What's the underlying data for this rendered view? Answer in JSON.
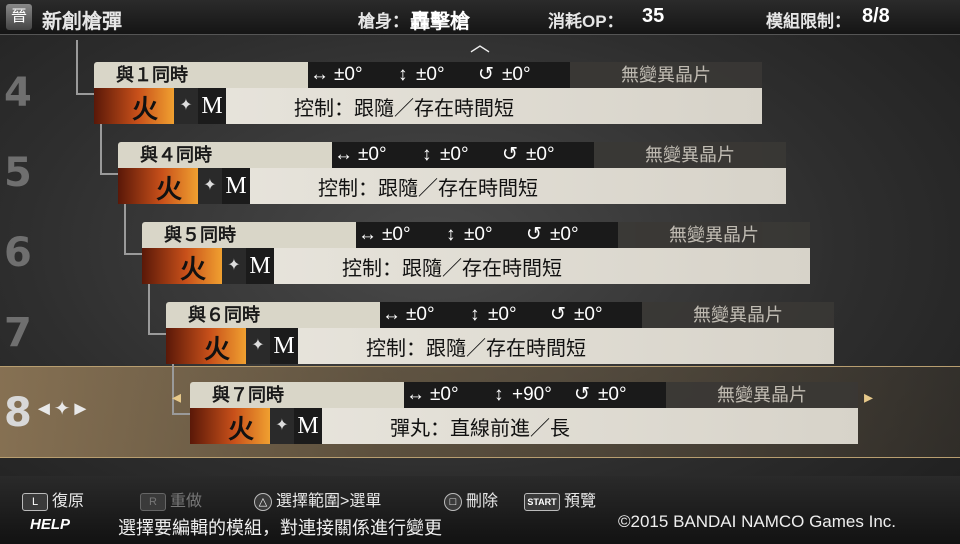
{
  "header": {
    "icon_glyph": "晉",
    "title": "新創槍彈",
    "gun_label": "槍身：",
    "gun_value": "轟擊槍",
    "cost_label": "消耗OP：",
    "cost_value": "35",
    "limit_label": "模組限制：",
    "limit_value": "8/8"
  },
  "levels": [
    "4",
    "5",
    "6",
    "7",
    "8"
  ],
  "entries": [
    {
      "cond": "與１同時",
      "h": "±0°",
      "v": "±0°",
      "r": "±0°",
      "crystal": "無變異晶片",
      "element": "火",
      "tag": "M",
      "desc": "控制：跟隨／存在時間短"
    },
    {
      "cond": "與４同時",
      "h": "±0°",
      "v": "±0°",
      "r": "±0°",
      "crystal": "無變異晶片",
      "element": "火",
      "tag": "M",
      "desc": "控制：跟隨／存在時間短"
    },
    {
      "cond": "與５同時",
      "h": "±0°",
      "v": "±0°",
      "r": "±0°",
      "crystal": "無變異晶片",
      "element": "火",
      "tag": "M",
      "desc": "控制：跟隨／存在時間短"
    },
    {
      "cond": "與６同時",
      "h": "±0°",
      "v": "±0°",
      "r": "±0°",
      "crystal": "無變異晶片",
      "element": "火",
      "tag": "M",
      "desc": "控制：跟隨／存在時間短"
    },
    {
      "cond": "與７同時",
      "h": "±0°",
      "v": "+90°",
      "r": "±0°",
      "crystal": "無變異晶片",
      "element": "火",
      "tag": "M",
      "desc": "彈丸：直線前進／長"
    }
  ],
  "icons": {
    "horizontal": "↔",
    "vertical": "↕",
    "rotate": "↺",
    "up": "︿",
    "left": "◂",
    "right": "▸",
    "diamond": "✦",
    "cursor": "◄✦►"
  },
  "footer": {
    "undo_key": "L",
    "undo_label": "復原",
    "redo_key": "R",
    "redo_label": "重做",
    "select_key": "△",
    "select_label": "選擇範圍>選單",
    "delete_key": "□",
    "delete_label": "刪除",
    "preview_key": "START",
    "preview_label": "預覽",
    "help": "HELP",
    "hint": "選擇要編輯的模組，對連接關係進行變更",
    "copyright": "©2015 BANDAI NAMCO Games Inc."
  }
}
